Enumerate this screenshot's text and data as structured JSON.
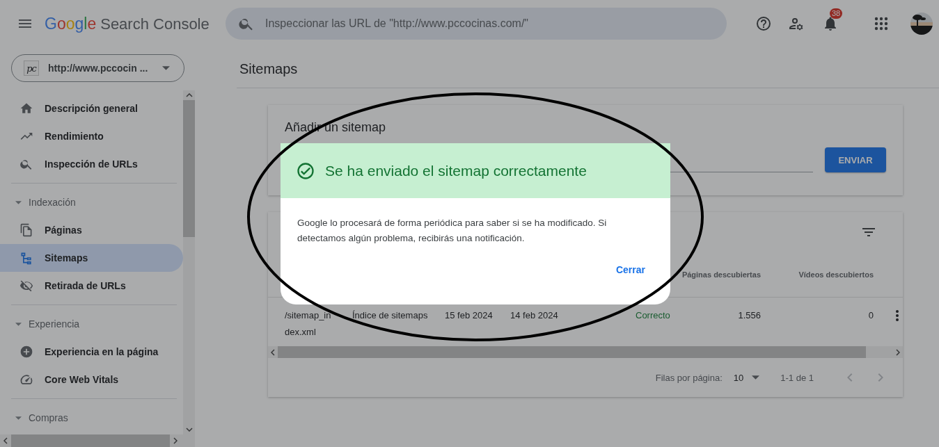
{
  "header": {
    "brand": "Google",
    "product": "Search Console",
    "search": {
      "placeholder": "Inspeccionar las URL de \"http://www.pccocinas.com/\""
    },
    "notifications": "38"
  },
  "property": {
    "favicon": "pc",
    "label": "http://www.pccocin ..."
  },
  "sidebar": {
    "groups": [
      {
        "items": [
          {
            "label": "Descripción general",
            "kind": "home",
            "selected": false
          },
          {
            "label": "Rendimiento",
            "kind": "trend",
            "selected": false
          },
          {
            "label": "Inspección de URLs",
            "kind": "search",
            "selected": false
          }
        ]
      },
      {
        "label": "Indexación",
        "expanded": true,
        "items": [
          {
            "label": "Páginas",
            "kind": "pages",
            "selected": false
          },
          {
            "label": "Sitemaps",
            "kind": "sitemap",
            "selected": true
          },
          {
            "label": "Retirada de URLs",
            "kind": "eyeoff",
            "selected": false
          }
        ]
      },
      {
        "label": "Experiencia",
        "expanded": true,
        "items": [
          {
            "label": "Experiencia en la página",
            "kind": "experience",
            "selected": false
          },
          {
            "label": "Core Web Vitals",
            "kind": "gauge",
            "selected": false
          }
        ]
      },
      {
        "label": "Compras",
        "expanded": true
      }
    ]
  },
  "page_title": "Sitemaps",
  "add_sitemap": {
    "title": "Añadir un sitemap",
    "button": "ENVIAR"
  },
  "table": {
    "columns": [
      {
        "label": "Páginas descubiertas"
      },
      {
        "label": "Vídeos descubiertos"
      }
    ],
    "rows": [
      {
        "sitemap": [
          "/sitemap_in",
          "dex.xml"
        ],
        "type": "Índice de sitemaps",
        "submitted": "15 feb 2024",
        "read": "14 feb 2024",
        "status": "Correcto",
        "pages": "1.556",
        "videos": "0"
      }
    ],
    "pagination": {
      "rows_label": "Filas por página:",
      "rows_value": "10",
      "range": "1-1 de 1"
    }
  },
  "dialog": {
    "title": "Se ha enviado el sitemap correctamente",
    "body": "Google lo procesará de forma periódica para saber si se ha modificado. Si detectamos algún problema, recibirás una notificación.",
    "button": "Cerrar"
  }
}
